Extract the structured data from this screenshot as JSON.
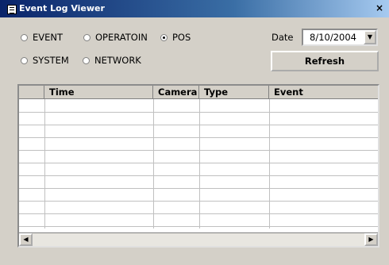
{
  "window": {
    "title": "Event Log Viewer",
    "close_glyph": "×"
  },
  "filters": {
    "options": [
      {
        "label": "EVENT",
        "checked": false
      },
      {
        "label": "OPERATOIN",
        "checked": false
      },
      {
        "label": "POS",
        "checked": true
      },
      {
        "label": "SYSTEM",
        "checked": false
      },
      {
        "label": "NETWORK",
        "checked": false
      }
    ]
  },
  "date": {
    "label": "Date",
    "value": "8/10/2004"
  },
  "refresh": {
    "label": "Refresh"
  },
  "table": {
    "columns": [
      "Time",
      "Camera",
      "Type",
      "Event"
    ],
    "rows": []
  }
}
